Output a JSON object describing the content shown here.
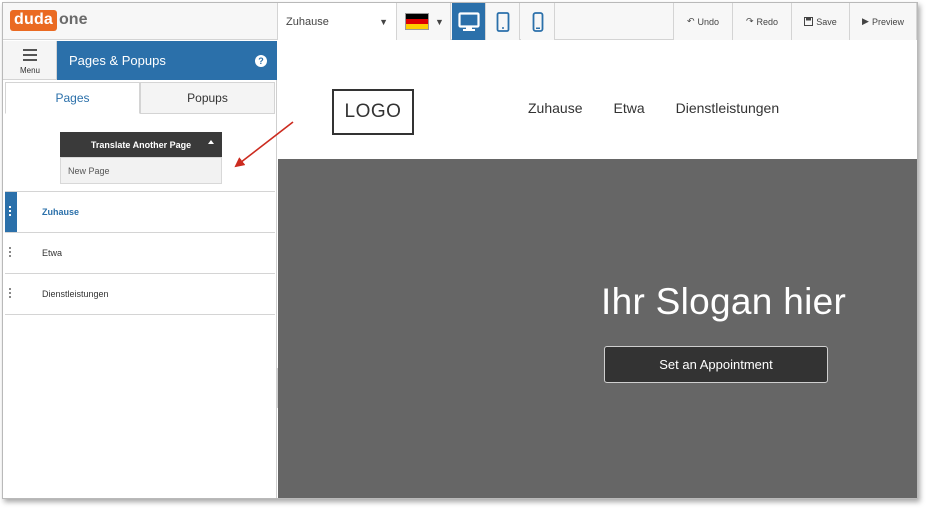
{
  "app": {
    "logo_part1": "duda",
    "logo_part2": "one"
  },
  "toolbar": {
    "page_select_value": "Zuhause",
    "language_flag": "german-flag",
    "devices": [
      "desktop-icon",
      "tablet-icon",
      "mobile-icon"
    ],
    "active_device": "desktop",
    "undo_label": "Undo",
    "redo_label": "Redo",
    "save_label": "Save",
    "preview_label": "Preview"
  },
  "sidebar": {
    "menu_label": "Menu",
    "header_title": "Pages & Popups",
    "help_icon": "?",
    "tabs": [
      {
        "label": "Pages",
        "active": true
      },
      {
        "label": "Popups",
        "active": false
      }
    ],
    "translate_button_label": "Translate Another Page",
    "dropdown_item": "New Page",
    "pages": [
      {
        "label": "Zuhause",
        "active": true
      },
      {
        "label": "Etwa",
        "active": false
      },
      {
        "label": "Dienstleistungen",
        "active": false
      }
    ]
  },
  "site": {
    "logo_text": "LOGO",
    "nav": [
      "Zuhause",
      "Etwa",
      "Dienstleistungen"
    ],
    "slogan": "Ihr Slogan hier",
    "cta_label": "Set an Appointment"
  },
  "colors": {
    "brand_orange": "#ea6a22",
    "accent_blue": "#2b70aa",
    "hero_gray": "#666666",
    "annotation_red": "#cc2b1f"
  }
}
